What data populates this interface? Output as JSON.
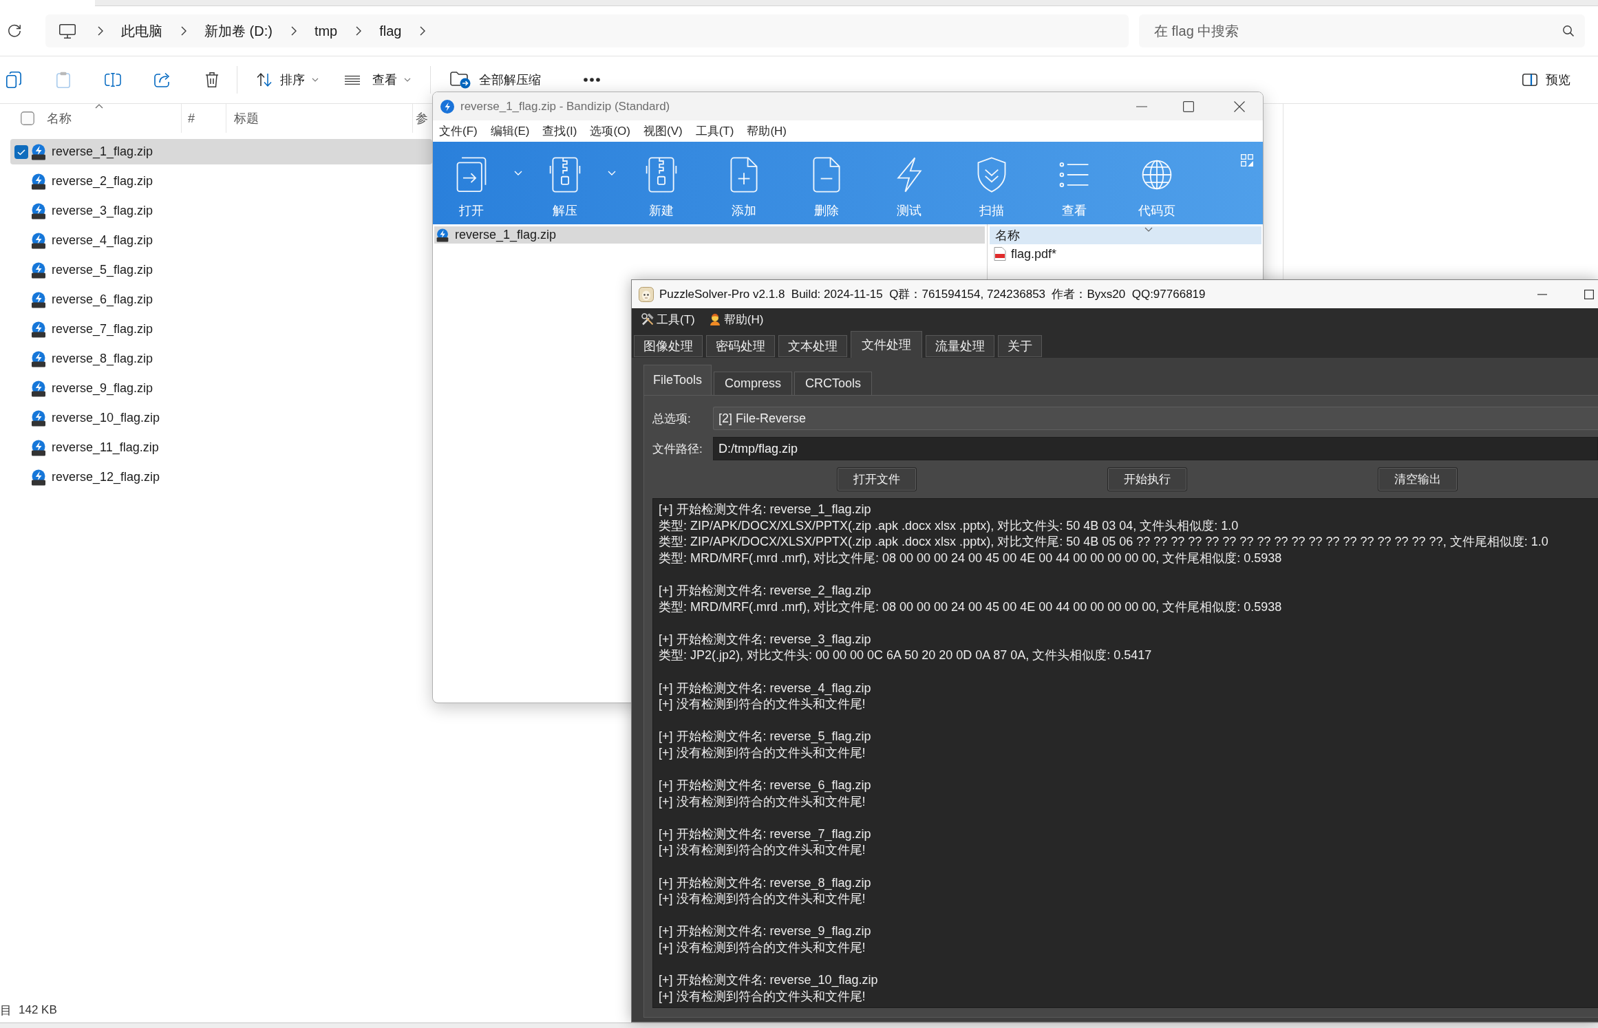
{
  "explorer": {
    "breadcrumb": [
      "此电脑",
      "新加卷 (D:)",
      "tmp",
      "flag"
    ],
    "search": {
      "placeholder": "在 flag 中搜索"
    },
    "toolbar": {
      "paste_disabled": true,
      "sort": "排序",
      "view": "查看",
      "extract_all": "全部解压缩",
      "preview": "预览"
    },
    "select_all_checked": false,
    "columns": [
      "名称",
      "#",
      "标题",
      "参"
    ],
    "files": [
      {
        "name": "reverse_1_flag.zip",
        "selected": true
      },
      {
        "name": "reverse_2_flag.zip",
        "selected": false
      },
      {
        "name": "reverse_3_flag.zip",
        "selected": false
      },
      {
        "name": "reverse_4_flag.zip",
        "selected": false
      },
      {
        "name": "reverse_5_flag.zip",
        "selected": false
      },
      {
        "name": "reverse_6_flag.zip",
        "selected": false
      },
      {
        "name": "reverse_7_flag.zip",
        "selected": false
      },
      {
        "name": "reverse_8_flag.zip",
        "selected": false
      },
      {
        "name": "reverse_9_flag.zip",
        "selected": false
      },
      {
        "name": "reverse_10_flag.zip",
        "selected": false
      },
      {
        "name": "reverse_11_flag.zip",
        "selected": false
      },
      {
        "name": "reverse_12_flag.zip",
        "selected": false
      }
    ],
    "status_bar": {
      "selection": "目",
      "size": "142 KB"
    }
  },
  "bandizip": {
    "title": "reverse_1_flag.zip - Bandizip (Standard)",
    "menu": [
      "文件(F)",
      "编辑(E)",
      "查找(I)",
      "选项(O)",
      "视图(V)",
      "工具(T)",
      "帮助(H)"
    ],
    "toolbar": [
      {
        "label": "打开",
        "dropdown": true
      },
      {
        "label": "解压",
        "dropdown": true
      },
      {
        "label": "新建",
        "dropdown": false
      },
      {
        "label": "添加",
        "dropdown": false
      },
      {
        "label": "删除",
        "dropdown": false
      },
      {
        "label": "测试",
        "dropdown": false
      },
      {
        "label": "扫描",
        "dropdown": false
      },
      {
        "label": "查看",
        "dropdown": false
      },
      {
        "label": "代码页",
        "dropdown": false
      }
    ],
    "archive_tree": [
      {
        "name": "reverse_1_flag.zip",
        "selected": true
      }
    ],
    "contents": {
      "column": "名称",
      "files": [
        {
          "name": "flag.pdf*",
          "selected": false
        }
      ]
    }
  },
  "puzzlesolver": {
    "title": "PuzzleSolver-Pro v2.1.8  Build: 2024-11-15  Q群：761594154, 724236853  作者：Byxs20  QQ:97766819",
    "menu": [
      "工具(T)",
      "帮助(H)"
    ],
    "tabs": [
      {
        "label": "图像处理",
        "selected": false
      },
      {
        "label": "密码处理",
        "selected": false
      },
      {
        "label": "文本处理",
        "selected": false
      },
      {
        "label": "文件处理",
        "selected": true
      },
      {
        "label": "流量处理",
        "selected": false
      },
      {
        "label": "关于",
        "selected": false
      }
    ],
    "subtabs": [
      {
        "label": "FileTools",
        "selected": true
      },
      {
        "label": "Compress",
        "selected": false
      },
      {
        "label": "CRCTools",
        "selected": false
      }
    ],
    "fields": [
      {
        "kind": "combo",
        "label": "总选项:",
        "value": "[2] File-Reverse"
      },
      {
        "kind": "input",
        "label": "文件路径:",
        "value": "D:/tmp/flag.zip"
      }
    ],
    "buttons": [
      "打开文件",
      "开始执行",
      "清空输出"
    ],
    "output": [
      [
        "[+] 开始检测文件名: reverse_1_flag.zip",
        "类型: ZIP/APK/DOCX/XLSX/PPTX(.zip .apk .docx xlsx .pptx), 对比文件头: 50 4B 03 04, 文件头相似度: 1.0",
        "类型: ZIP/APK/DOCX/XLSX/PPTX(.zip .apk .docx xlsx .pptx), 对比文件尾: 50 4B 05 06 ?? ?? ?? ?? ?? ?? ?? ?? ?? ?? ?? ?? ?? ?? ?? ?? ?? ??, 文件尾相似度: 1.0",
        "类型: MRD/MRF(.mrd .mrf), 对比文件尾: 08 00 00 00 24 00 45 00 4E 00 44 00 00 00 00 00, 文件尾相似度: 0.5938"
      ],
      [
        "[+] 开始检测文件名: reverse_2_flag.zip",
        "类型: MRD/MRF(.mrd .mrf), 对比文件尾: 08 00 00 00 24 00 45 00 4E 00 44 00 00 00 00 00, 文件尾相似度: 0.5938"
      ],
      [
        "[+] 开始检测文件名: reverse_3_flag.zip",
        "类型: JP2(.jp2), 对比文件头: 00 00 00 0C 6A 50 20 20 0D 0A 87 0A, 文件头相似度: 0.5417"
      ],
      [
        "[+] 开始检测文件名: reverse_4_flag.zip",
        "[+] 没有检测到符合的文件头和文件尾!"
      ],
      [
        "[+] 开始检测文件名: reverse_5_flag.zip",
        "[+] 没有检测到符合的文件头和文件尾!"
      ],
      [
        "[+] 开始检测文件名: reverse_6_flag.zip",
        "[+] 没有检测到符合的文件头和文件尾!"
      ],
      [
        "[+] 开始检测文件名: reverse_7_flag.zip",
        "[+] 没有检测到符合的文件头和文件尾!"
      ],
      [
        "[+] 开始检测文件名: reverse_8_flag.zip",
        "[+] 没有检测到符合的文件头和文件尾!"
      ],
      [
        "[+] 开始检测文件名: reverse_9_flag.zip",
        "[+] 没有检测到符合的文件头和文件尾!"
      ],
      [
        "[+] 开始检测文件名: reverse_10_flag.zip",
        "[+] 没有检测到符合的文件头和文件尾!"
      ]
    ]
  }
}
